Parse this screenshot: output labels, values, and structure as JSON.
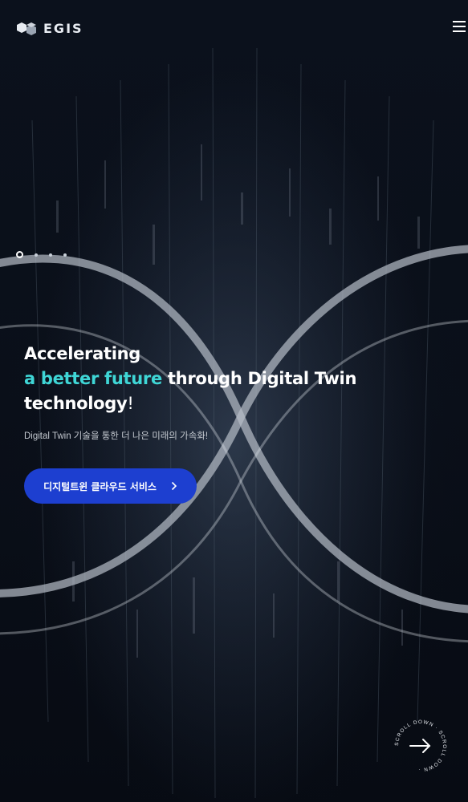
{
  "header": {
    "logo_text": "EGIS",
    "menu_icon": "hamburger-menu-icon"
  },
  "slider": {
    "total": 4,
    "active_index": 0
  },
  "hero": {
    "line1": "Accelerating",
    "line2_accent": "a better future",
    "line2_rest": " through Digital Twin",
    "line3": "technology",
    "line3_punct": "!",
    "subtitle": "Digital Twin 기술을 통한 더 나은 미래의 가속화!",
    "cta_label": "디지털트윈 클라우드 서비스",
    "cta_icon": "chevron-right-icon"
  },
  "scroll": {
    "label": "SCROLL DOWN · SCROLL DOWN ·",
    "icon": "arrow-right-icon"
  },
  "colors": {
    "background": "#0a0f1a",
    "accent": "#3fd6d6",
    "cta": "#1d3fd0",
    "text": "#ffffff",
    "muted": "#c3c8cf"
  }
}
